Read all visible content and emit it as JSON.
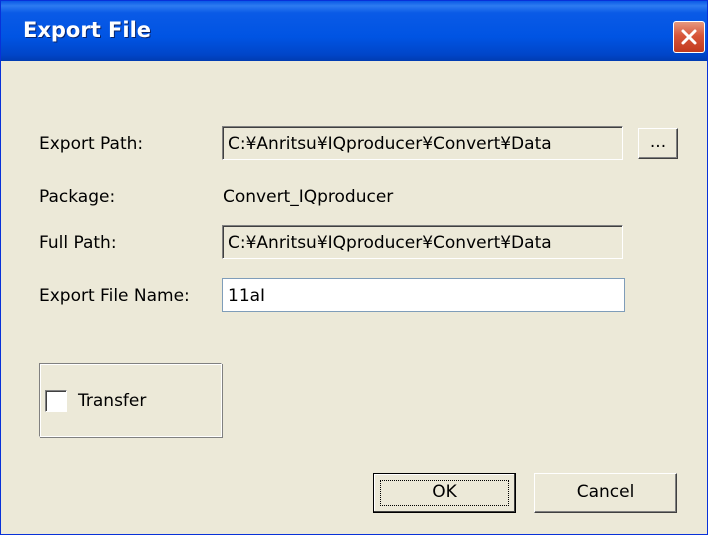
{
  "dialog": {
    "title": "Export File"
  },
  "form": {
    "export_path_label": "Export Path:",
    "export_path_value": "C:¥Anritsu¥IQproducer¥Convert¥Data",
    "browse_label": "...",
    "package_label": "Package:",
    "package_value": "Convert_IQproducer",
    "full_path_label": "Full Path:",
    "full_path_value": "C:¥Anritsu¥IQproducer¥Convert¥Data",
    "file_name_label": "Export File Name:",
    "file_name_value": "11aI"
  },
  "transfer": {
    "label": "Transfer",
    "checked": false
  },
  "buttons": {
    "ok_label": "OK",
    "cancel_label": "Cancel"
  },
  "colors": {
    "titlebar": "#0054e3",
    "close": "#d8563a",
    "dialog_bg": "#ece9d8"
  }
}
